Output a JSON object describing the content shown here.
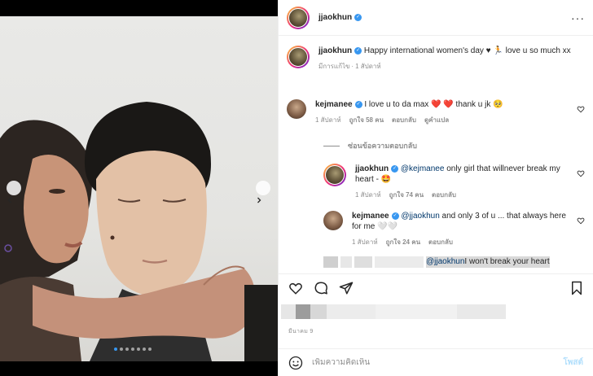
{
  "post": {
    "author": "jjaokhun",
    "media": {
      "carousel_count": 7,
      "active_index": 0
    }
  },
  "caption": {
    "username": "jjaokhun",
    "text": "Happy international women's day ♥ 🏃 love u so much xx",
    "edited_label": "มีการแก้ไข",
    "time": "1 สัปดาห์"
  },
  "comments": [
    {
      "username": "kejmanee",
      "text": "I love u to da max ❤️ ❤️  thank u jk 🥺",
      "time": "1 สัปดาห์",
      "likes": "ถูกใจ 58 คน",
      "reply_label": "ตอบกลับ",
      "translate_label": "ดูคำแปล"
    }
  ],
  "replies_toggle": "ซ่อนข้อความตอบกลับ",
  "replies": [
    {
      "username": "jjaokhun",
      "mention": "@kejmanee",
      "text": " only girl that willnever break my heart - 🤩",
      "time": "1 สัปดาห์",
      "likes": "ถูกใจ 74 คน",
      "reply_label": "ตอบกลับ"
    },
    {
      "username": "kejmanee",
      "mention": "@jjaokhun",
      "text": " and only 3 of u ... that always here for me 🤍🤍",
      "time": "1 สัปดาห์",
      "likes": "ถูกใจ 24 คน",
      "reply_label": "ตอบกลับ"
    },
    {
      "mention": "@jjaokhun",
      "text": " I won't break your heart"
    }
  ],
  "footer": {
    "date": "มีนาคม 9",
    "comment_placeholder": "เพิ่มความคิดเห็น",
    "post_label": "โพสต์"
  },
  "colors": {
    "accent": "#3897f0",
    "heart_red": "#ed4956",
    "muted": "#8e8e8e",
    "post_disabled": "#b2dffc"
  }
}
